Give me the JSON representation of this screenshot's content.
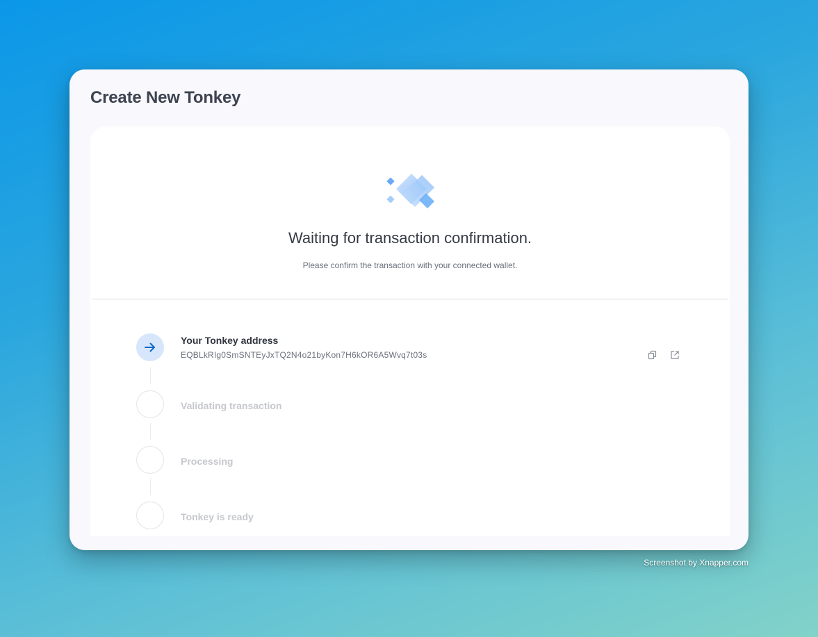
{
  "window": {
    "title": "Create New Tonkey"
  },
  "status": {
    "title": "Waiting for transaction confirmation.",
    "subtitle": "Please confirm the transaction with your connected wallet."
  },
  "steps": [
    {
      "label": "Your Tonkey address",
      "state": "active",
      "icon": "arrow-right-icon"
    },
    {
      "label": "Validating transaction",
      "state": "pending"
    },
    {
      "label": "Processing",
      "state": "pending"
    },
    {
      "label": "Tonkey is ready",
      "state": "pending"
    }
  ],
  "address": {
    "value": "EQBLkRIg0SmSNTEyJxTQ2N4o21byKon7H6kOR6A5Wvq7t03s",
    "actions": [
      "copy-icon",
      "external-link-icon"
    ]
  },
  "colors": {
    "accent": "#0a6bc7",
    "active_circle": "#d7e6fb",
    "logo_light": "#a9cdfb",
    "logo_dark": "#5aa2f2"
  },
  "watermark": "Screenshot by Xnapper.com"
}
